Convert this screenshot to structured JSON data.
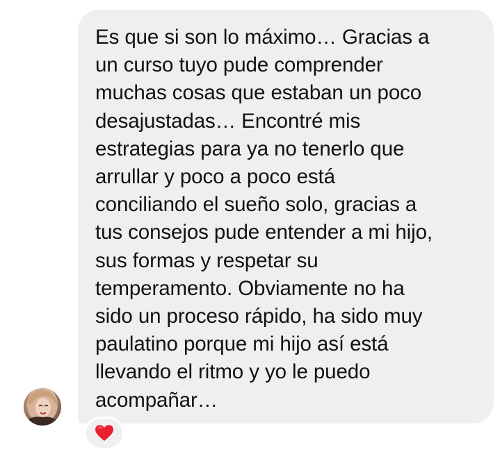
{
  "message": {
    "text": "Es que si son lo máximo… Gracias a\nun curso tuyo pude comprender\nmuchas cosas que estaban un poco\ndesajustadas… Encontré mis\nestrategias para ya no tenerlo que\narrullar y poco a poco está\nconciliando el sueño solo, gracias a\ntus consejos pude entender a mi hijo,\nsus formas y respetar su\ntemperamento. Obviamente no ha\nsido un proceso rápido, ha sido muy\npaulatino porque mi hijo así está\nllevando el ritmo y yo le puedo\nacompañar…",
    "bubble_color": "#efeff0",
    "text_color": "#111111"
  },
  "sender": {
    "avatar_icon": "user-avatar-photo"
  },
  "reaction": {
    "icon": "red-heart-icon",
    "color": "#e8202e"
  }
}
